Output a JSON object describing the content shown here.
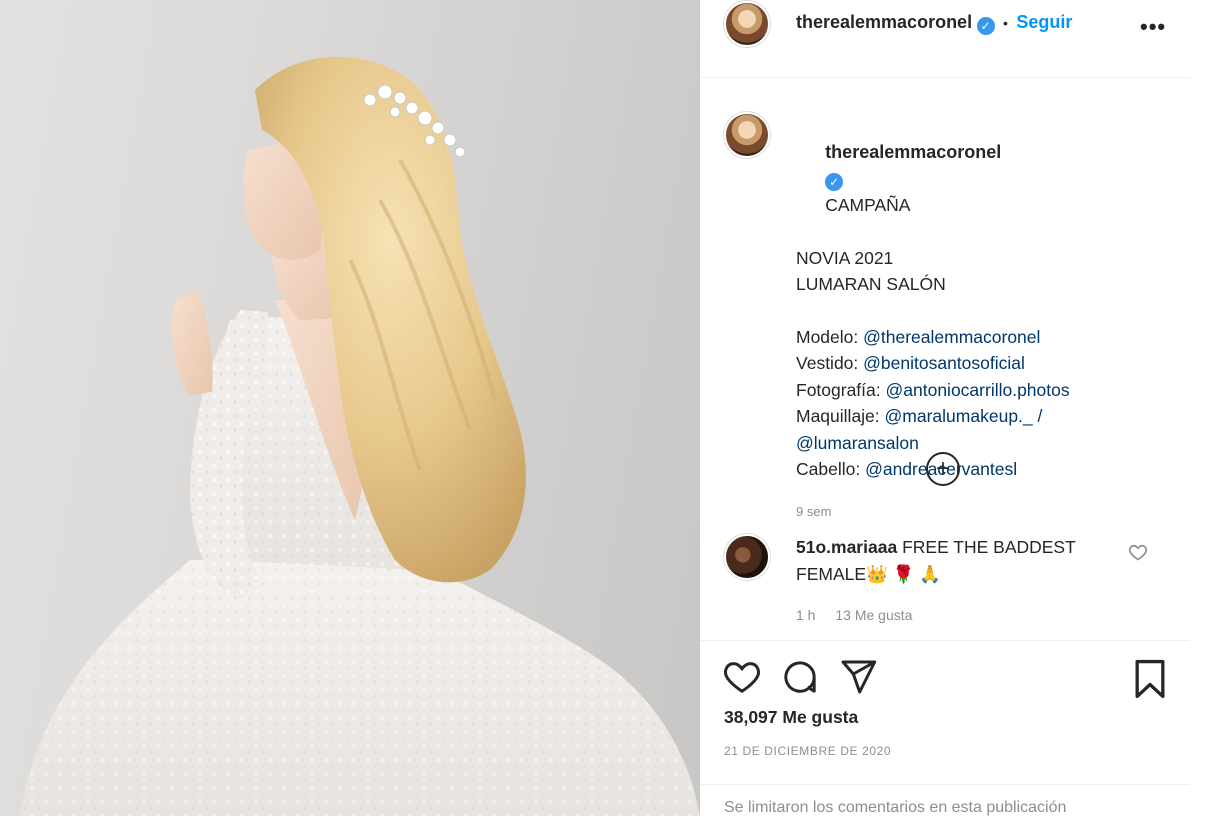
{
  "post": {
    "photo_alt": "photo",
    "header": {
      "username": "therealemmacoronel",
      "verified_icon": "verified-badge-icon",
      "separator": "•",
      "follow_label": "Seguir",
      "more_label": "•••"
    },
    "caption": {
      "username": "therealemmacoronel",
      "text_line1": "CAMPAÑA",
      "text_line2": "NOVIA 2021",
      "text_line3": "LUMARAN SALÓN",
      "credits": [
        {
          "label": "Modelo: ",
          "mention": "@therealemmacoronel"
        },
        {
          "label": "Vestido: ",
          "mention": "@benitosantosoficial"
        },
        {
          "label": "Fotografía: ",
          "mention": "@antoniocarrillo.photos"
        },
        {
          "label": "Maquillaje: ",
          "mention": "@maralumakeup._ /"
        },
        {
          "label": "",
          "mention": "@lumaransalon"
        },
        {
          "label": "Cabello: ",
          "mention": "@andreacervantesl"
        }
      ],
      "time": "9 sem"
    },
    "load_more_label": "+",
    "comment": {
      "username": "51o.mariaaa",
      "text": "FREE THE BADDEST FEMALE",
      "emojis": "👑 🌹 🙏",
      "time": "1 h",
      "likes": "13 Me gusta"
    },
    "likes": "38,097 Me gusta",
    "date": "21 DE DICIEMBRE DE 2020",
    "comments_limited": "Se limitaron los comentarios en esta publicación"
  },
  "colors": {
    "link": "#00376b",
    "follow": "#0095f6",
    "verified": "#3897f0",
    "muted": "#8e8e8e"
  }
}
